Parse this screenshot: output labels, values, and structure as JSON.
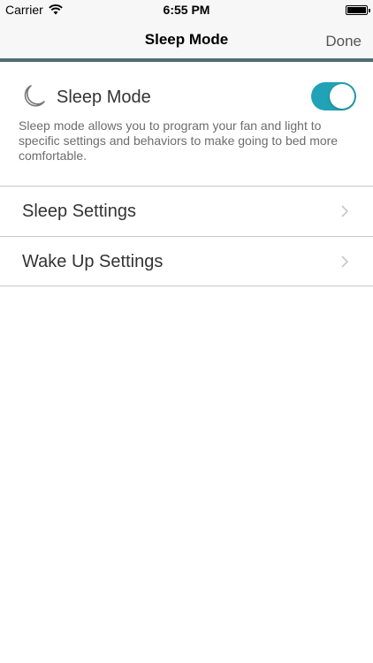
{
  "status_bar": {
    "carrier": "Carrier",
    "time": "6:55 PM"
  },
  "nav": {
    "title": "Sleep Mode",
    "done_label": "Done"
  },
  "sleep_mode": {
    "label": "Sleep Mode",
    "enabled": true,
    "toggle_color": "#21a2b6",
    "description": "Sleep mode allows you to program your fan and light to specific settings and behaviors to make going to bed more comfortable."
  },
  "settings": [
    {
      "label": "Sleep Settings"
    },
    {
      "label": "Wake Up Settings"
    }
  ],
  "colors": {
    "accent_bar": "#4f6b74",
    "nav_background": "#f7f7f7"
  },
  "icons": {
    "moon": "moon-icon",
    "chevron": "chevron-right-icon",
    "wifi": "wifi-icon",
    "battery": "battery-icon"
  }
}
